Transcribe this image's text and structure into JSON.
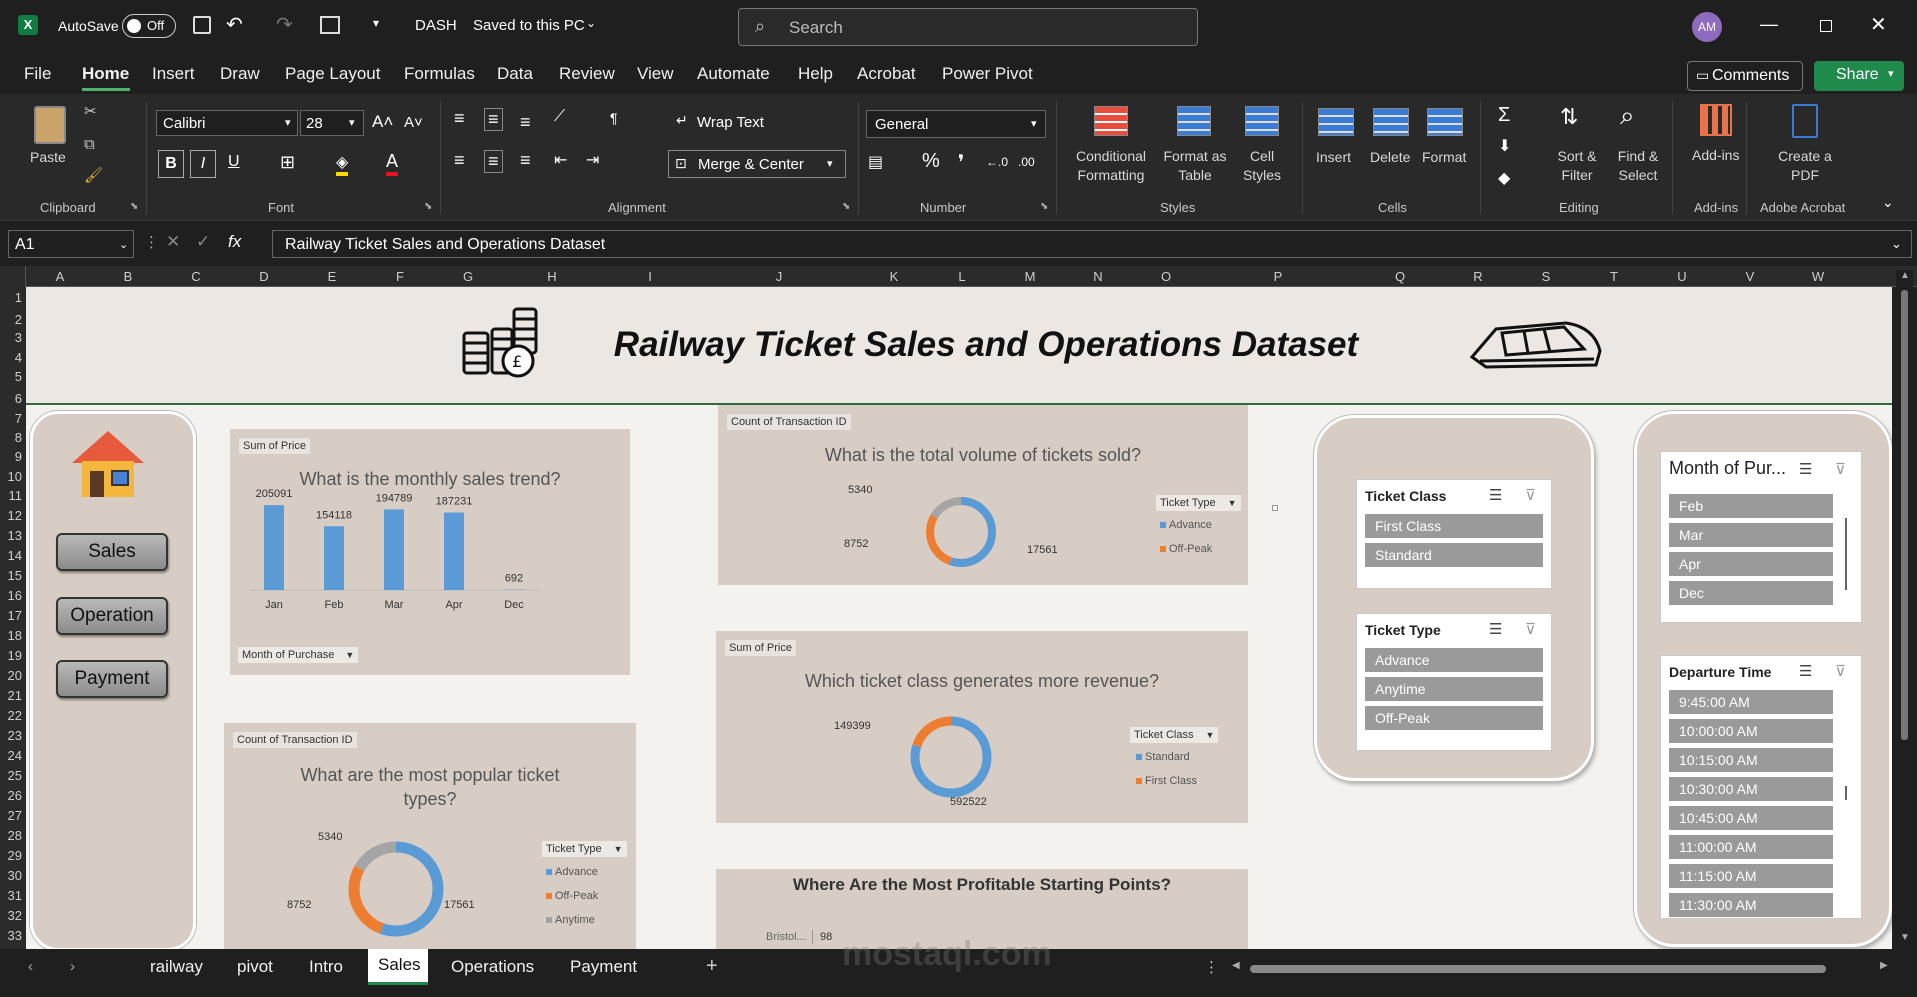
{
  "app": {
    "autosave_label": "AutoSave",
    "autosave_state": "Off",
    "file_name": "DASH",
    "save_status": "Saved to this PC",
    "search_placeholder": "Search",
    "user_initials": "AM"
  },
  "menu": [
    "File",
    "Home",
    "Insert",
    "Draw",
    "Page Layout",
    "Formulas",
    "Data",
    "Review",
    "View",
    "Automate",
    "Help",
    "Acrobat",
    "Power Pivot"
  ],
  "menu_right": {
    "comments": "Comments",
    "share": "Share"
  },
  "ribbon": {
    "clipboard": {
      "paste": "Paste",
      "group": "Clipboard"
    },
    "font": {
      "name": "Calibri",
      "size": "28",
      "group": "Font"
    },
    "alignment": {
      "wrap": "Wrap Text",
      "merge": "Merge & Center",
      "group": "Alignment"
    },
    "number": {
      "format": "General",
      "group": "Number"
    },
    "styles": {
      "cond": "Conditional Formatting",
      "table": "Format as Table",
      "cell": "Cell Styles",
      "group": "Styles"
    },
    "cells": {
      "insert": "Insert",
      "delete": "Delete",
      "format": "Format",
      "group": "Cells"
    },
    "editing": {
      "sort": "Sort & Filter",
      "find": "Find & Select",
      "group": "Editing"
    },
    "addins": {
      "label": "Add-ins",
      "group": "Add-ins"
    },
    "acrobat": {
      "label": "Create a PDF",
      "group": "Adobe Acrobat"
    }
  },
  "formula": {
    "namebox": "A1",
    "fx": "fx",
    "content": "Railway Ticket Sales and Operations Dataset"
  },
  "columns": [
    "A",
    "B",
    "C",
    "D",
    "E",
    "F",
    "G",
    "H",
    "I",
    "J",
    "K",
    "L",
    "M",
    "N",
    "O",
    "P",
    "Q",
    "R",
    "S",
    "T",
    "U",
    "V",
    "W"
  ],
  "rows": [
    "1",
    "2",
    "3",
    "4",
    "5",
    "6",
    "7",
    "8",
    "9",
    "10",
    "11",
    "12",
    "13",
    "14",
    "15",
    "16",
    "17",
    "18",
    "19",
    "20",
    "21",
    "22",
    "23",
    "24",
    "25",
    "26",
    "27",
    "28",
    "29",
    "30",
    "31",
    "32",
    "33"
  ],
  "dashboard": {
    "title": "Railway Ticket Sales and Operations Dataset",
    "nav": [
      "Sales",
      "Operation",
      "Payment"
    ],
    "chart1": {
      "tag": "Sum of Price",
      "title": "What is the monthly sales trend?",
      "filter": "Month of Purchase"
    },
    "chart2": {
      "tag": "Count of Transaction ID",
      "title": "What is the total volume of tickets sold?",
      "legend_title": "Ticket Type",
      "legend": [
        "Advance",
        "Off-Peak"
      ],
      "labels": [
        "5340",
        "8752",
        "17561"
      ]
    },
    "chart3": {
      "tag": "Sum of Price",
      "title": "Which ticket class generates more revenue?",
      "legend_title": "Ticket Class",
      "legend": [
        "Standard",
        "First Class"
      ],
      "labels": [
        "149399",
        "592522"
      ]
    },
    "chart4": {
      "tag": "Count of Transaction ID",
      "title_line1": "What are the most popular ticket",
      "title_line2": "types?",
      "legend_title": "Ticket Type",
      "legend": [
        "Advance",
        "Off-Peak",
        "Anytime"
      ],
      "labels": [
        "5340",
        "8752",
        "17561"
      ]
    },
    "chart5": {
      "title": "Where Are the Most Profitable Starting Points?",
      "first_label": "Bristol...",
      "first_value": "98"
    },
    "slicer_class": {
      "title": "Ticket Class",
      "items": [
        "First Class",
        "Standard"
      ]
    },
    "slicer_type": {
      "title": "Ticket Type",
      "items": [
        "Advance",
        "Anytime",
        "Off-Peak"
      ]
    },
    "slicer_month": {
      "title": "Month of Pur...",
      "items": [
        "Feb",
        "Mar",
        "Apr",
        "Dec"
      ]
    },
    "slicer_time": {
      "title": "Departure Time",
      "items": [
        "9:45:00 AM",
        "10:00:00 AM",
        "10:15:00 AM",
        "10:30:00 AM",
        "10:45:00 AM",
        "11:00:00 AM",
        "11:15:00 AM",
        "11:30:00 AM"
      ]
    }
  },
  "chart_data": [
    {
      "type": "bar",
      "categories": [
        "Jan",
        "Feb",
        "Mar",
        "Apr",
        "Dec"
      ],
      "values": [
        205091,
        154118,
        194789,
        187231,
        692
      ],
      "title": "What is the monthly sales trend?",
      "ylabel": "Sum of Price",
      "ylim": [
        0,
        220000
      ],
      "colors": [
        "#5b9bd5"
      ]
    },
    {
      "type": "pie",
      "categories": [
        "Advance",
        "Off-Peak",
        "Anytime"
      ],
      "values": [
        17561,
        8752,
        5340
      ],
      "title": "What is the total volume of tickets sold?",
      "donut": true,
      "colors": [
        "#5b9bd5",
        "#ed7d31",
        "#a5a5a5"
      ]
    },
    {
      "type": "pie",
      "categories": [
        "Standard",
        "First Class"
      ],
      "values": [
        592522,
        149399
      ],
      "title": "Which ticket class generates more revenue?",
      "donut": true,
      "colors": [
        "#5b9bd5",
        "#ed7d31"
      ]
    },
    {
      "type": "pie",
      "categories": [
        "Advance",
        "Off-Peak",
        "Anytime"
      ],
      "values": [
        17561,
        8752,
        5340
      ],
      "title": "What are the most popular ticket types?",
      "donut": true,
      "colors": [
        "#5b9bd5",
        "#ed7d31",
        "#a5a5a5"
      ]
    }
  ],
  "tabs": [
    "railway",
    "pivot",
    "Intro",
    "Sales",
    "Operations",
    "Payment"
  ],
  "watermark": "mostaql.com"
}
